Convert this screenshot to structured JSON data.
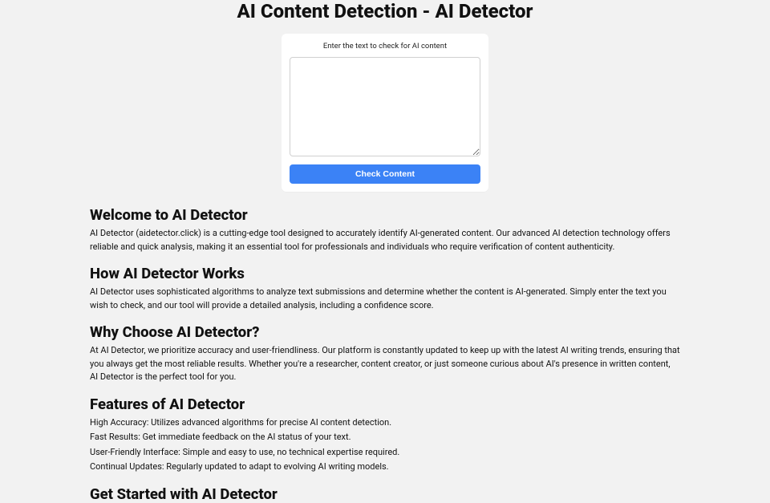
{
  "header": {
    "title": "AI Content Detection - AI Detector"
  },
  "form": {
    "label": "Enter the text to check for AI content",
    "textarea_value": "",
    "button_label": "Check Content"
  },
  "sections": {
    "welcome": {
      "heading": "Welcome to AI Detector",
      "body": "AI Detector (aidetector.click) is a cutting-edge tool designed to accurately identify AI-generated content. Our advanced AI detection technology offers reliable and quick analysis, making it an essential tool for professionals and individuals who require verification of content authenticity."
    },
    "how": {
      "heading": "How AI Detector Works",
      "body": "AI Detector uses sophisticated algorithms to analyze text submissions and determine whether the content is AI-generated. Simply enter the text you wish to check, and our tool will provide a detailed analysis, including a confidence score."
    },
    "why": {
      "heading": "Why Choose AI Detector?",
      "body": "At AI Detector, we prioritize accuracy and user-friendliness. Our platform is constantly updated to keep up with the latest AI writing trends, ensuring that you always get the most reliable results. Whether you're a researcher, content creator, or just someone curious about AI's presence in written content, AI Detector is the perfect tool for you."
    },
    "features": {
      "heading": "Features of AI Detector",
      "line1": "High Accuracy: Utilizes advanced algorithms for precise AI content detection.",
      "line2": "Fast Results: Get immediate feedback on the AI status of your text.",
      "line3": "User-Friendly Interface: Simple and easy to use, no technical expertise required.",
      "line4": "Continual Updates: Regularly updated to adapt to evolving AI writing models."
    },
    "getstarted": {
      "heading": "Get Started with AI Detector"
    }
  }
}
